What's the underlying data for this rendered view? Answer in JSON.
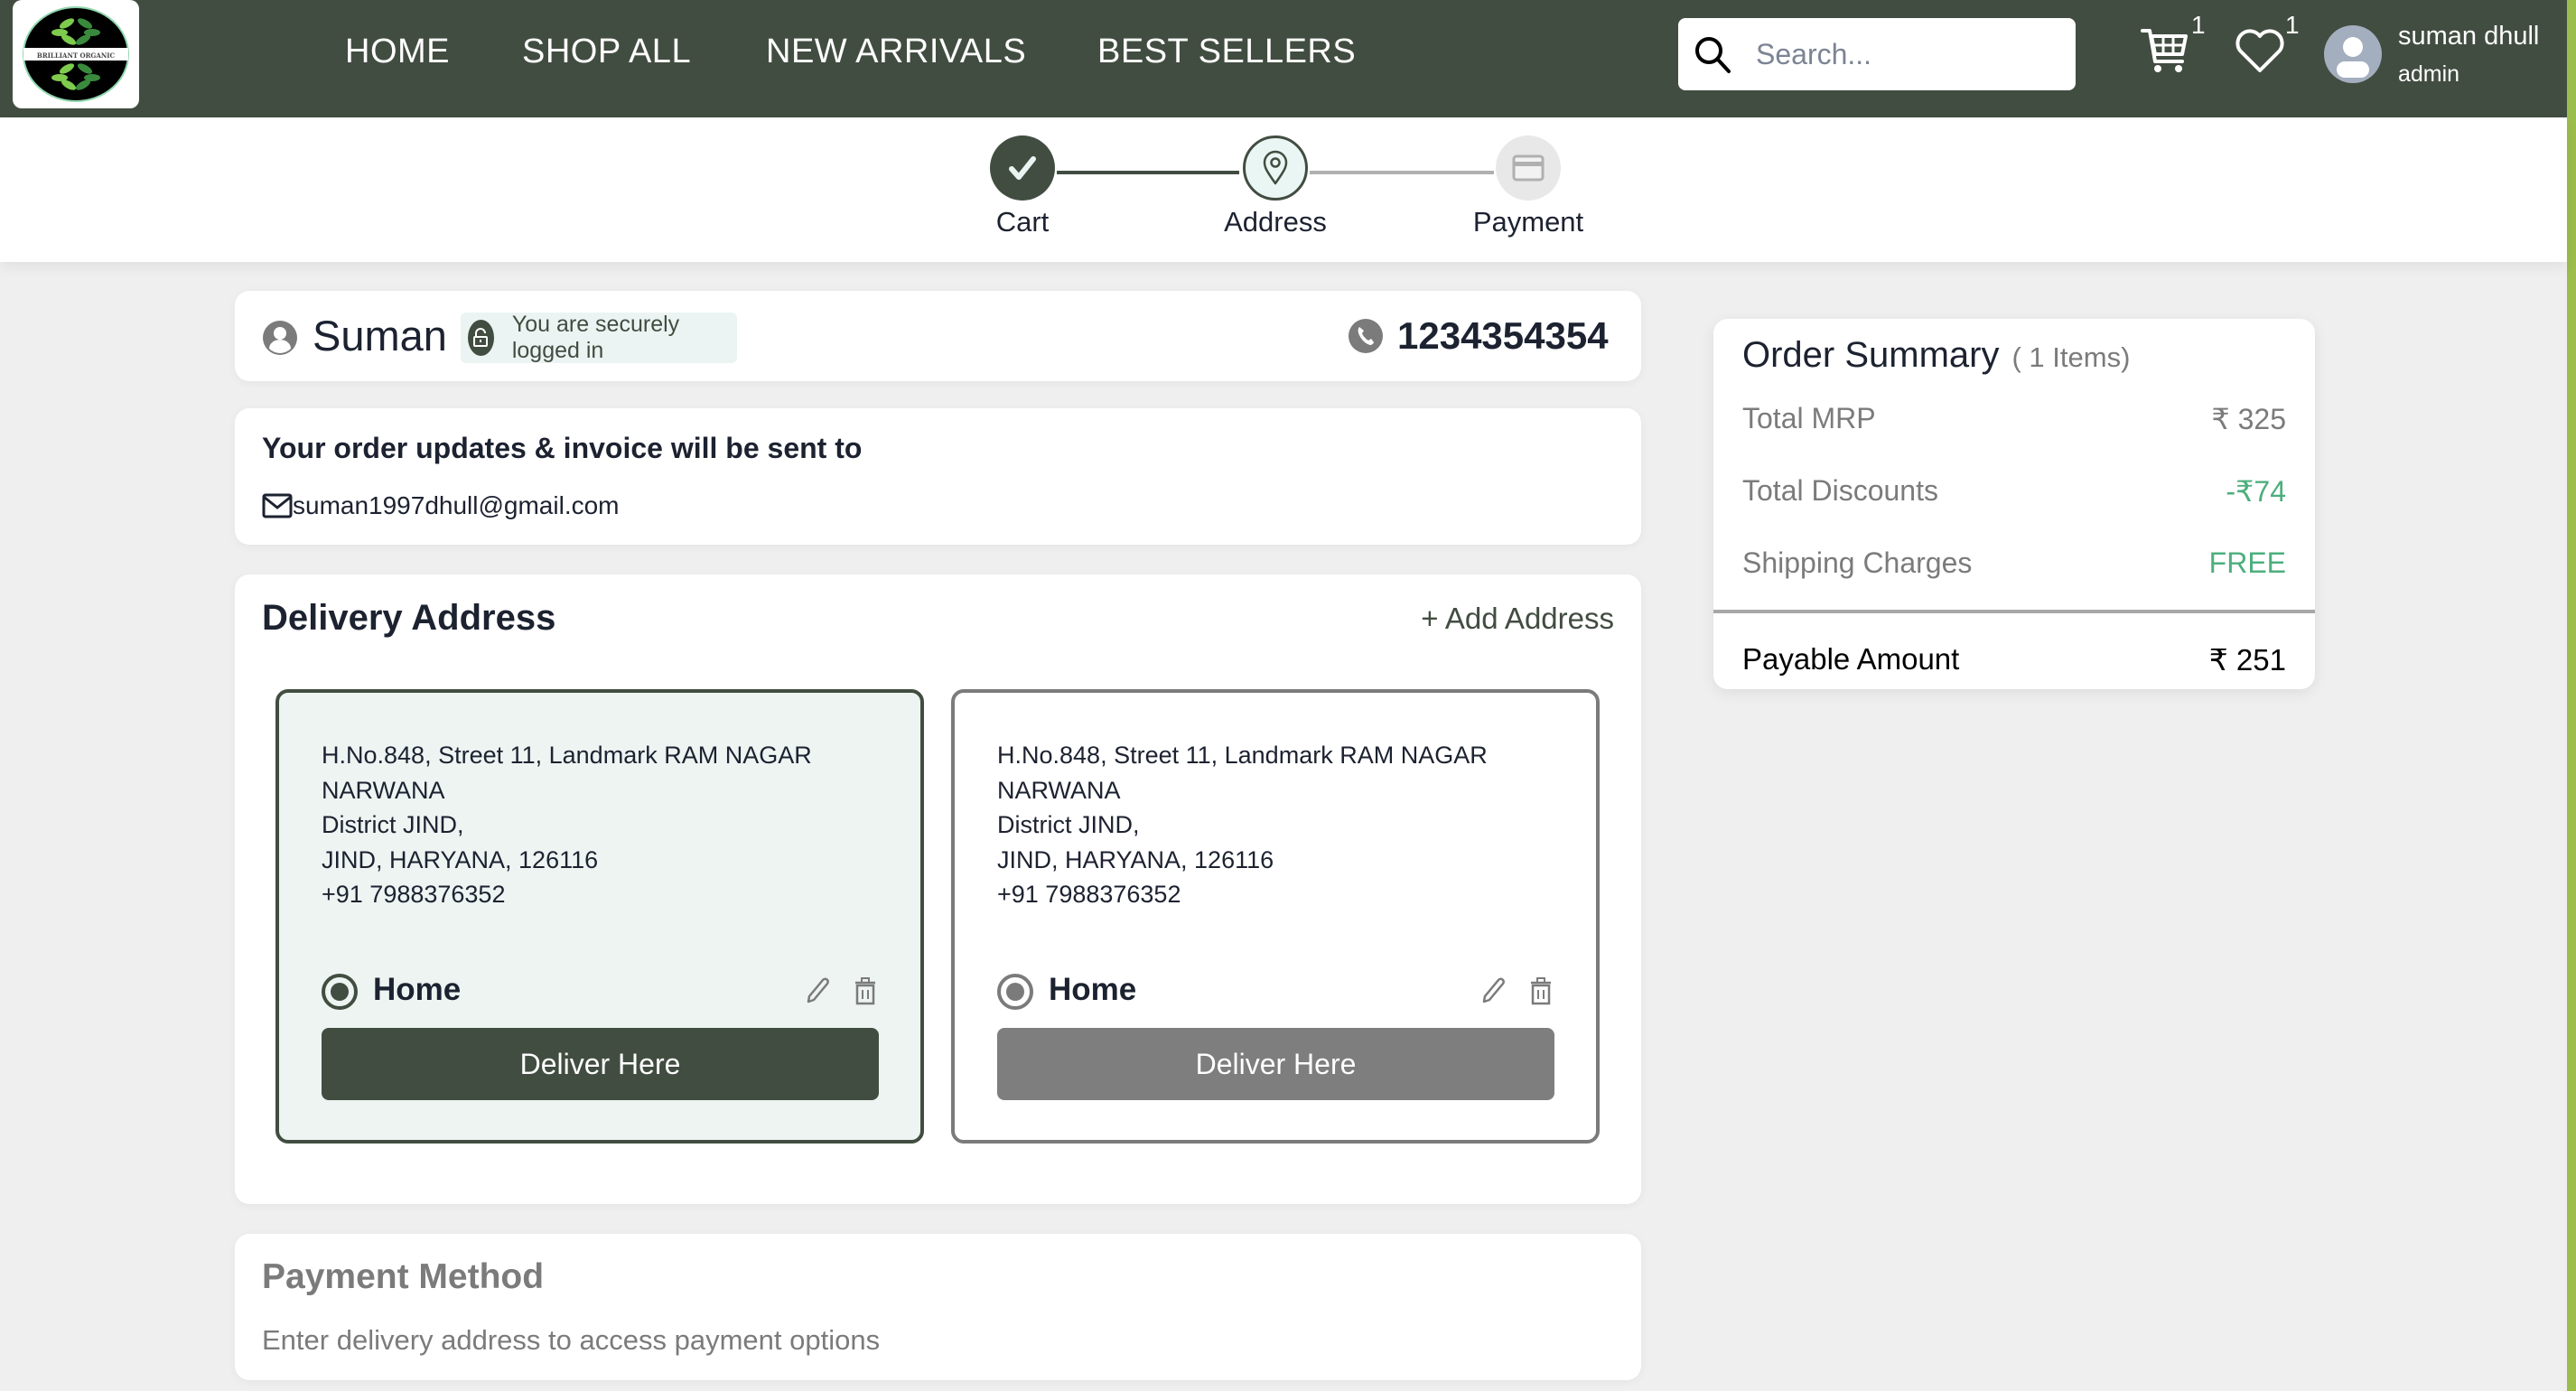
{
  "brand": {
    "logo_text": "BRILLIANT ORGANIC"
  },
  "nav": {
    "items": [
      {
        "label": "HOME"
      },
      {
        "label": "SHOP ALL"
      },
      {
        "label": "NEW ARRIVALS"
      },
      {
        "label": "BEST SELLERS"
      }
    ]
  },
  "search": {
    "placeholder": "Search...",
    "value": ""
  },
  "header": {
    "cart_count": "1",
    "wishlist_count": "1",
    "user_name": "suman dhull",
    "user_role": "admin"
  },
  "stepper": {
    "steps": [
      {
        "label": "Cart",
        "state": "completed"
      },
      {
        "label": "Address",
        "state": "active"
      },
      {
        "label": "Payment",
        "state": "pending"
      }
    ]
  },
  "user_card": {
    "name": "Suman",
    "secure_text": "You are securely logged in",
    "phone": "1234354354"
  },
  "email_card": {
    "title": "Your order updates & invoice will be sent to",
    "email": "suman1997dhull@gmail.com"
  },
  "delivery": {
    "title": "Delivery Address",
    "add_label": "+ Add Address",
    "addresses": [
      {
        "lines": [
          "H.No.848, Street 11, Landmark RAM NAGAR",
          "NARWANA",
          "District JIND,",
          "JIND, HARYANA, 126116",
          "+91 7988376352"
        ],
        "type": "Home",
        "button": "Deliver Here",
        "selected": true
      },
      {
        "lines": [
          "H.No.848, Street 11, Landmark RAM NAGAR",
          "NARWANA",
          "District JIND,",
          "JIND, HARYANA, 126116",
          "+91 7988376352"
        ],
        "type": "Home",
        "button": "Deliver Here",
        "selected": false
      }
    ]
  },
  "payment": {
    "title": "Payment Method",
    "subtitle": "Enter delivery address to access payment options"
  },
  "summary": {
    "title": "Order Summary",
    "count": "( 1 Items)",
    "rows": [
      {
        "label": "Total MRP",
        "value": "₹ 325"
      },
      {
        "label": "Total Discounts",
        "value": "-₹74"
      },
      {
        "label": "Shipping Charges",
        "value": "FREE"
      }
    ],
    "total_label": "Payable Amount",
    "total_value": "₹ 251"
  },
  "colors": {
    "primary": "#424d41",
    "accent_green": "#4caf7d",
    "scrollbar": "#9bbd4c",
    "disabled": "#7b7b7b",
    "selected_bg": "#edf4f2"
  }
}
